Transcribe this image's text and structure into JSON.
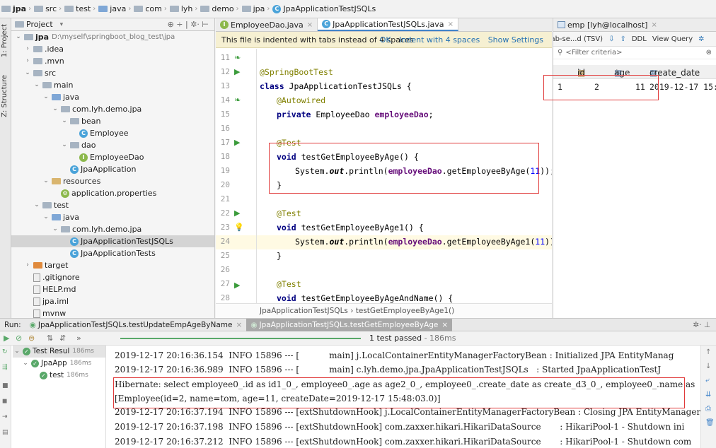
{
  "breadcrumbs": [
    "jpa",
    "src",
    "test",
    "java",
    "com",
    "lyh",
    "demo",
    "jpa",
    "JpaApplicationTestJSQLs"
  ],
  "left_strip": {
    "project_tab": "1: Project",
    "structure_tab": "Z: Structure"
  },
  "project_panel": {
    "header": "Project",
    "tree": [
      {
        "label": "jpa",
        "note": "D:\\myself\\springboot_blog_test\\jpa",
        "type": "folder",
        "indent": 0,
        "open": true
      },
      {
        "label": ".idea",
        "type": "folder",
        "indent": 1,
        "open": false
      },
      {
        "label": ".mvn",
        "type": "folder",
        "indent": 1,
        "open": false
      },
      {
        "label": "src",
        "type": "folder",
        "indent": 1,
        "open": true
      },
      {
        "label": "main",
        "type": "folder",
        "indent": 2,
        "open": true
      },
      {
        "label": "java",
        "type": "folder-blue",
        "indent": 3,
        "open": true
      },
      {
        "label": "com.lyh.demo.jpa",
        "type": "folder",
        "indent": 4,
        "open": true
      },
      {
        "label": "bean",
        "type": "folder",
        "indent": 5,
        "open": true
      },
      {
        "label": "Employee",
        "type": "class",
        "indent": 6
      },
      {
        "label": "dao",
        "type": "folder",
        "indent": 5,
        "open": true
      },
      {
        "label": "EmployeeDao",
        "type": "interface",
        "indent": 6
      },
      {
        "label": "JpaApplication",
        "type": "class",
        "indent": 5
      },
      {
        "label": "resources",
        "type": "folder-gold",
        "indent": 3,
        "open": true
      },
      {
        "label": "application.properties",
        "type": "props",
        "indent": 4
      },
      {
        "label": "test",
        "type": "folder",
        "indent": 2,
        "open": true
      },
      {
        "label": "java",
        "type": "folder-blue",
        "indent": 3,
        "open": true
      },
      {
        "label": "com.lyh.demo.jpa",
        "type": "folder",
        "indent": 4,
        "open": true
      },
      {
        "label": "JpaApplicationTestJSQLs",
        "type": "class",
        "indent": 5,
        "selected": true
      },
      {
        "label": "JpaApplicationTests",
        "type": "class",
        "indent": 5
      },
      {
        "label": "target",
        "type": "folder-orange",
        "indent": 1,
        "open": false
      },
      {
        "label": ".gitignore",
        "type": "file",
        "indent": 1
      },
      {
        "label": "HELP.md",
        "type": "file",
        "indent": 1
      },
      {
        "label": "jpa.iml",
        "type": "file",
        "indent": 1
      },
      {
        "label": "mvnw",
        "type": "file",
        "indent": 1
      }
    ]
  },
  "editor": {
    "tabs": [
      {
        "label": "EmployeeDao.java",
        "active": false
      },
      {
        "label": "JpaApplicationTestJSQLs.java",
        "active": true
      }
    ],
    "notice": "This file is indented with tabs instead of 4 spaces",
    "notice_ok": "OK",
    "notice_indent": "Indent with 4 spaces",
    "notice_settings": "Show Settings",
    "line_numbers": [
      "11",
      "12",
      "13",
      "14",
      "15",
      "16",
      "17",
      "18",
      "19",
      "20",
      "21",
      "22",
      "23",
      "24",
      "25",
      "26",
      "27",
      "28"
    ],
    "code": {
      "l12": "@SpringBootTest",
      "l13_kw": "class",
      "l13": " JpaApplicationTestJSQLs {",
      "l14": "@Autowired",
      "l15_kw": "private",
      "l15_type": " EmployeeDao ",
      "l15_field": "employeeDao",
      "l15_end": ";",
      "l17": "@Test",
      "l18_kw": "void",
      "l18": " testGetEmployeeByAge() {",
      "l19_a": "System.",
      "l19_out": "out",
      "l19_b": ".println(",
      "l19_field": "employeeDao",
      "l19_c": ".getEmployeeByAge(",
      "l19_num": "11",
      "l19_d": "));",
      "l20": "}",
      "l22": "@Test",
      "l23_kw": "void",
      "l23": " testGetEmployeeByAge1() {",
      "l24_a": "System.",
      "l24_out": "out",
      "l24_b": ".println(",
      "l24_field": "employeeDao",
      "l24_c": ".getEmployeeByAge1(",
      "l24_num": "11",
      "l24_d": "));",
      "l25": "}",
      "l27": "@Test",
      "l28_kw": "void",
      "l28": " testGetEmployeeByAgeAndName() {"
    },
    "breadcrumb": "JpaApplicationTestJSQLs  ›  testGetEmployeeByAge1()"
  },
  "db_panel": {
    "tab": "emp [lyh@localhost]",
    "toolbar": [
      "Tab-se...d (TSV)",
      "DDL",
      "View Query"
    ],
    "filter": "<Filter criteria>",
    "columns": [
      "id",
      "age",
      "create_date"
    ],
    "rows": [
      {
        "row": "1",
        "id": "2",
        "age": "11",
        "create_date": "2019-12-17 15:4"
      }
    ]
  },
  "run_panel": {
    "label": "Run:",
    "tabs": [
      {
        "label": "JpaApplicationTestJSQLs.testUpdateEmpAgeByName",
        "active": false
      },
      {
        "label": "JpaApplicationTestJSQLs.testGetEmployeeByAge",
        "active": true
      }
    ],
    "status": "1 test passed",
    "status_time": "- 186ms",
    "tests": [
      {
        "label": "Test Resul",
        "time": "186ms"
      },
      {
        "label": "JpaApp",
        "time": "186ms"
      },
      {
        "label": "test",
        "time": "186ms"
      }
    ],
    "console": [
      "2019-12-17 20:16:36.154  INFO 15896 --- [           main] j.LocalContainerEntityManagerFactoryBean : Initialized JPA EntityManag",
      "2019-12-17 20:16:36.989  INFO 15896 --- [           main] c.lyh.demo.jpa.JpaApplicationTestJSQLs   : Started JpaApplicationTestJ",
      "Hibernate: select employee0_.id as id1_0_, employee0_.age as age2_0_, employee0_.create_date as create_d3_0_, employee0_.name as",
      "[Employee(id=2, name=tom, age=11, createDate=2019-12-17 15:48:03.0)]",
      "2019-12-17 20:16:37.194  INFO 15896 --- [extShutdownHook] j.LocalContainerEntityManagerFactoryBean : Closing JPA EntityManagerFa",
      "2019-12-17 20:16:37.198  INFO 15896 --- [extShutdownHook] com.zaxxer.hikari.HikariDataSource       : HikariPool-1 - Shutdown ini",
      "2019-12-17 20:16:37.212  INFO 15896 --- [extShutdownHook] com.zaxxer.hikari.HikariDataSource       : HikariPool-1 - Shutdown com"
    ]
  },
  "colors": {
    "accent": "#4083c9",
    "pass": "#59a869",
    "highlight_box": "#e03a3a"
  }
}
